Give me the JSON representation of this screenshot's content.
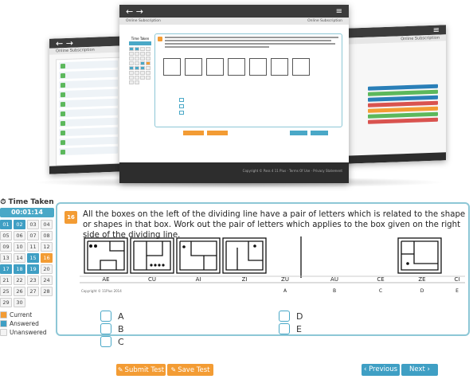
{
  "hero": {
    "front_window": {
      "title": "Online Subscription",
      "sub_right": "Online Subscription",
      "footer_text": "Copyright © Pass 4 11 Plus · Terms Of Use · Privacy Statement",
      "time_title": "Time Taken"
    },
    "back_window": {
      "title": "Online Subscription",
      "sub_right": "Online Subscription"
    },
    "nav_arrows": "← →",
    "menu_icon": "≡",
    "side_bar_colors": [
      "#2a7fb8",
      "#5cb85c",
      "#2a7fb8",
      "#d9534f",
      "#f39c34",
      "#5cb85c",
      "#d9534f"
    ]
  },
  "sidebar": {
    "time_title": "Time Taken",
    "timer": "00:01:14",
    "questions": [
      {
        "n": "01",
        "state": "answered"
      },
      {
        "n": "02",
        "state": "answered"
      },
      {
        "n": "03",
        "state": "none"
      },
      {
        "n": "04",
        "state": "none"
      },
      {
        "n": "05",
        "state": "none"
      },
      {
        "n": "06",
        "state": "none"
      },
      {
        "n": "07",
        "state": "none"
      },
      {
        "n": "08",
        "state": "none"
      },
      {
        "n": "09",
        "state": "none"
      },
      {
        "n": "10",
        "state": "none"
      },
      {
        "n": "11",
        "state": "none"
      },
      {
        "n": "12",
        "state": "none"
      },
      {
        "n": "13",
        "state": "none"
      },
      {
        "n": "14",
        "state": "none"
      },
      {
        "n": "15",
        "state": "answered"
      },
      {
        "n": "16",
        "state": "current"
      },
      {
        "n": "17",
        "state": "answered"
      },
      {
        "n": "18",
        "state": "answered"
      },
      {
        "n": "19",
        "state": "answered"
      },
      {
        "n": "20",
        "state": "none"
      },
      {
        "n": "21",
        "state": "none"
      },
      {
        "n": "22",
        "state": "none"
      },
      {
        "n": "23",
        "state": "none"
      },
      {
        "n": "24",
        "state": "none"
      },
      {
        "n": "25",
        "state": "none"
      },
      {
        "n": "26",
        "state": "none"
      },
      {
        "n": "27",
        "state": "none"
      },
      {
        "n": "28",
        "state": "none"
      },
      {
        "n": "29",
        "state": "none"
      },
      {
        "n": "30",
        "state": "none"
      }
    ],
    "legend": [
      {
        "label": "Current",
        "color": "#f39c34"
      },
      {
        "label": "Answered",
        "color": "#3f9fc4"
      },
      {
        "label": "Unanswered",
        "color": "#f4f4f4"
      }
    ]
  },
  "question": {
    "number": "16",
    "text": "All the boxes on the left of the dividing line have a pair of letters which is related to the shape or shapes in that box. Work out the pair of letters which applies to the box given on the right side of the dividing line.",
    "box_labels": [
      "AE",
      "CU",
      "AI",
      "ZI",
      "ZU",
      "AU",
      "CE",
      "ZE",
      "CI"
    ],
    "option_letters": [
      "A",
      "B",
      "C",
      "D",
      "E"
    ],
    "copyright": "Copyright © 11Plus 2014",
    "options": [
      {
        "label": "A"
      },
      {
        "label": "B"
      },
      {
        "label": "C"
      },
      {
        "label": "D"
      },
      {
        "label": "E"
      }
    ]
  },
  "actions": {
    "submit": "Submit Test",
    "save": "Save Test",
    "previous": "‹ Previous",
    "next": "Next ›"
  },
  "colors": {
    "accent_blue": "#3f9fc4",
    "accent_orange": "#f39c34",
    "panel_border": "#8dc7d6"
  }
}
